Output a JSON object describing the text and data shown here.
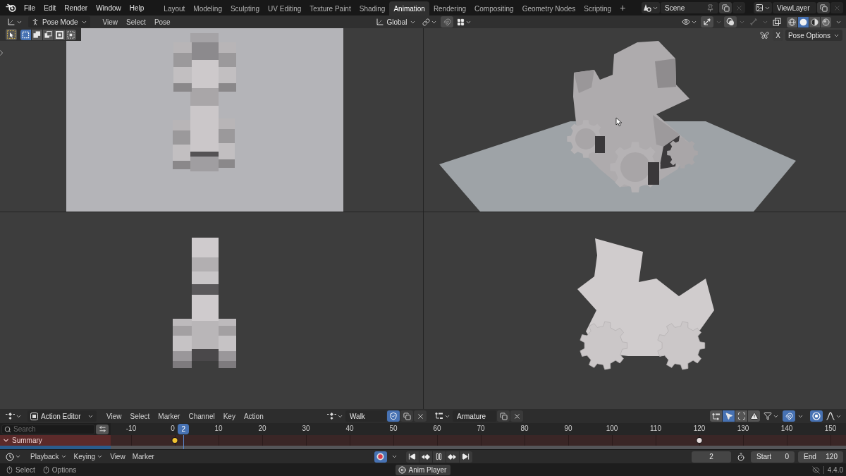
{
  "top_bar": {
    "menus": [
      "File",
      "Edit",
      "Render",
      "Window",
      "Help"
    ],
    "workspaces": [
      {
        "label": "Layout",
        "selected": false
      },
      {
        "label": "Modeling",
        "selected": false
      },
      {
        "label": "Sculpting",
        "selected": false
      },
      {
        "label": "UV Editing",
        "selected": false
      },
      {
        "label": "Texture Paint",
        "selected": false
      },
      {
        "label": "Shading",
        "selected": false
      },
      {
        "label": "Animation",
        "selected": true
      },
      {
        "label": "Rendering",
        "selected": false
      },
      {
        "label": "Compositing",
        "selected": false
      },
      {
        "label": "Geometry Nodes",
        "selected": false
      },
      {
        "label": "Scripting",
        "selected": false
      }
    ],
    "add_workspace": "+",
    "scene": "Scene",
    "view_layer": "ViewLayer"
  },
  "viewport_header": {
    "mode": "Pose Mode",
    "menus": [
      "View",
      "Select",
      "Pose"
    ],
    "orientation": "Global",
    "shading_modes": [
      {
        "kind": "wireframe",
        "selected": false
      },
      {
        "kind": "solid",
        "selected": true
      },
      {
        "kind": "material",
        "selected": false
      },
      {
        "kind": "rendered",
        "selected": false
      }
    ]
  },
  "tool_settings": {
    "select_modes": [
      {
        "kind": "set",
        "selected": true
      },
      {
        "kind": "extend",
        "selected": false
      },
      {
        "kind": "subtract",
        "selected": false
      },
      {
        "kind": "invert",
        "selected": false
      },
      {
        "kind": "intersect",
        "selected": false
      }
    ],
    "mirror_axis": "X",
    "pose_options": "Pose Options"
  },
  "dope_sheet": {
    "mode": "Action Editor",
    "menus": [
      "View",
      "Select",
      "Marker",
      "Channel",
      "Key",
      "Action"
    ],
    "action": "Walk",
    "fake_user": true,
    "slot": "Armature",
    "header_toggles": [
      {
        "kind": "summary",
        "on": false
      },
      {
        "kind": "only_selected",
        "on": true
      },
      {
        "kind": "hidden",
        "on": false
      },
      {
        "kind": "errors",
        "on": false
      }
    ],
    "auto_snap": true,
    "proportional": true,
    "search": {
      "placeholder": "Search"
    },
    "ruler": [
      {
        "label": "-10"
      },
      {
        "label": "0",
        "keyframe": {
          "selected": true
        }
      },
      {
        "label": "10"
      },
      {
        "label": "20"
      },
      {
        "label": "30"
      },
      {
        "label": "40"
      },
      {
        "label": "50"
      },
      {
        "label": "60"
      },
      {
        "label": "70"
      },
      {
        "label": "80"
      },
      {
        "label": "90"
      },
      {
        "label": "100"
      },
      {
        "label": "110"
      },
      {
        "label": "120",
        "keyframe": {
          "selected": false
        }
      },
      {
        "label": "130"
      },
      {
        "label": "140"
      },
      {
        "label": "150"
      }
    ],
    "current_frame": "2",
    "channels": [
      {
        "label": "Summary",
        "expanded": true
      }
    ]
  },
  "timeline": {
    "menus": [
      {
        "label": "Playback",
        "dropdown": true
      },
      {
        "label": "Keying",
        "dropdown": true
      },
      {
        "label": "View",
        "dropdown": false
      },
      {
        "label": "Marker",
        "dropdown": false
      }
    ],
    "auto_keying": true,
    "current_frame": "2",
    "start_label": "Start",
    "start": "0",
    "end_label": "End",
    "end": "120"
  },
  "status_bar": {
    "hints": [
      {
        "label": "Select"
      },
      {
        "label": "Options"
      }
    ],
    "report": "Anim Player",
    "version": "4.4.0"
  }
}
